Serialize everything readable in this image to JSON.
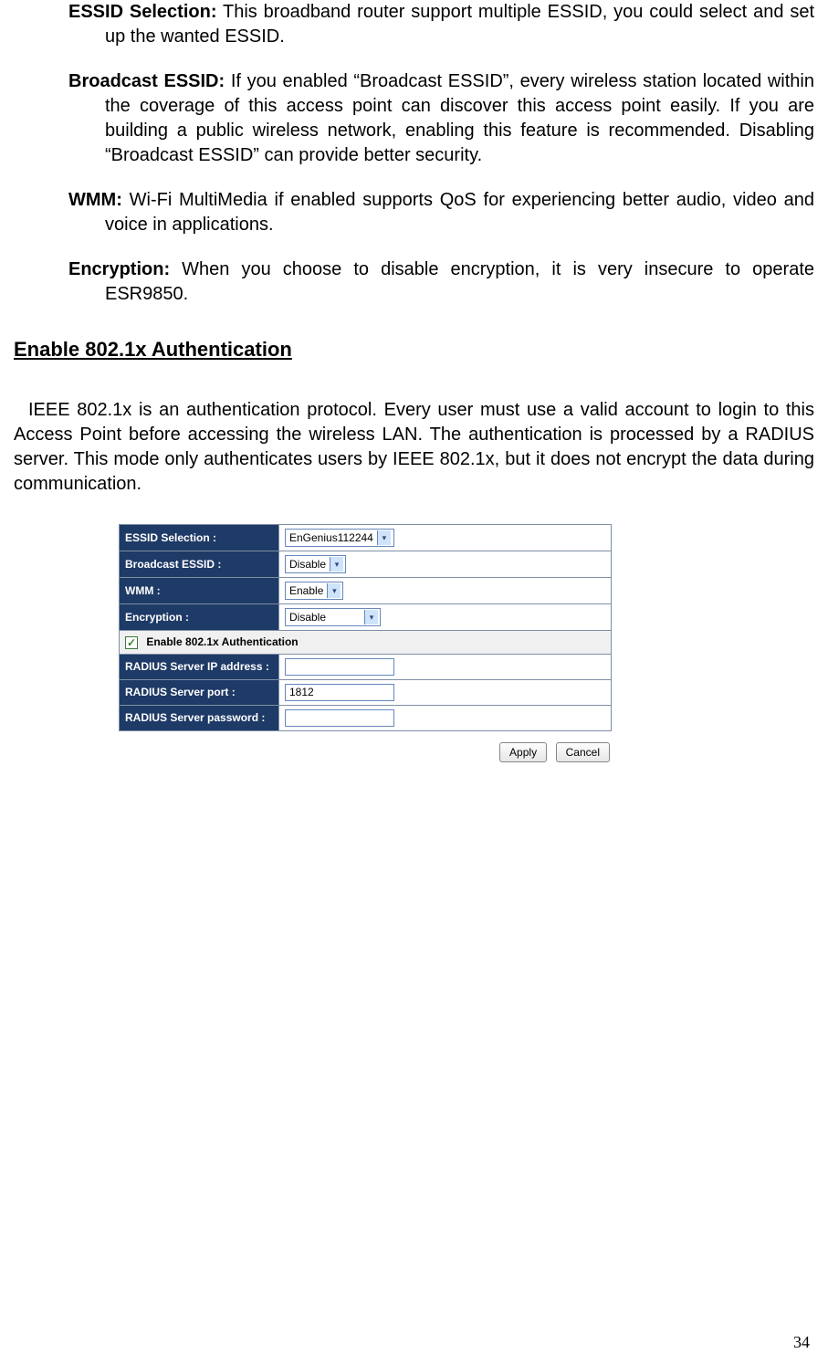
{
  "definitions": {
    "essid_sel": {
      "term": "ESSID Selection:",
      "text": " This broadband router support multiple ESSID, you could select and set up the wanted ESSID."
    },
    "broadcast": {
      "term": "Broadcast ESSID:",
      "text": " If you enabled “Broadcast ESSID”, every wireless station located within the coverage of this access point can discover this access point easily. If you are building a public wireless network, enabling this feature is recommended. Disabling “Broadcast ESSID” can provide better security."
    },
    "wmm": {
      "term": "WMM:",
      "text": " Wi-Fi MultiMedia if enabled supports QoS for experiencing better audio, video and voice in applications."
    },
    "encryption": {
      "term": "Encryption:",
      "text": " When you choose to disable encryption, it is very insecure to operate ESR9850."
    }
  },
  "heading": "Enable 802.1x Authentication",
  "intro": "IEEE 802.1x is an authentication protocol. Every user must use a valid account to login to this Access Point before accessing the wireless LAN. The authentication is processed by a RADIUS server. This mode only authenticates users by IEEE 802.1x, but it does not encrypt the data during communication.",
  "form": {
    "rows": {
      "essid_label": "ESSID Selection :",
      "essid_value": "EnGenius112244",
      "broadcast_label": "Broadcast ESSID :",
      "broadcast_value": "Disable",
      "wmm_label": "WMM :",
      "wmm_value": "Enable",
      "encryption_label": "Encryption :",
      "encryption_value": "Disable",
      "checkbox_label": "Enable 802.1x Authentication",
      "radius_ip_label": "RADIUS Server IP address :",
      "radius_ip_value": "",
      "radius_port_label": "RADIUS Server port :",
      "radius_port_value": "1812",
      "radius_pw_label": "RADIUS Server password :",
      "radius_pw_value": ""
    },
    "buttons": {
      "apply": "Apply",
      "cancel": "Cancel"
    }
  },
  "page_number": "34"
}
